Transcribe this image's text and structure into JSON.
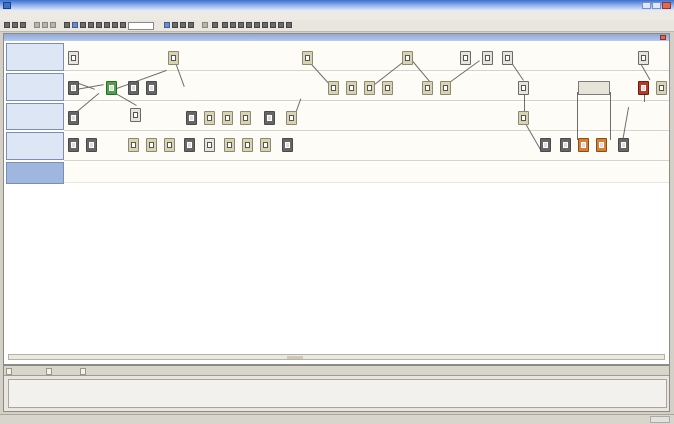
{
  "window": {
    "title": "",
    "menu": [
      "",
      "",
      "",
      "",
      "",
      "",
      "",
      ""
    ],
    "zoom_value": ""
  },
  "document": {
    "title": ""
  },
  "bottom_panel": {
    "tabs": [
      "",
      "",
      ""
    ]
  },
  "status": {
    "text": ""
  },
  "colors": {
    "titlebar": "#3b6fd0",
    "lane_header": "#dce6f4",
    "selected_lane_header": "#9fb7de",
    "block_dark": "#666666",
    "block_red": "#b23b2a",
    "block_orange": "#d77f34",
    "block_green": "#4ea24b"
  },
  "icons": [
    "app-icon",
    "minimize-icon",
    "maximize-icon",
    "close-icon",
    "block-icon"
  ]
}
